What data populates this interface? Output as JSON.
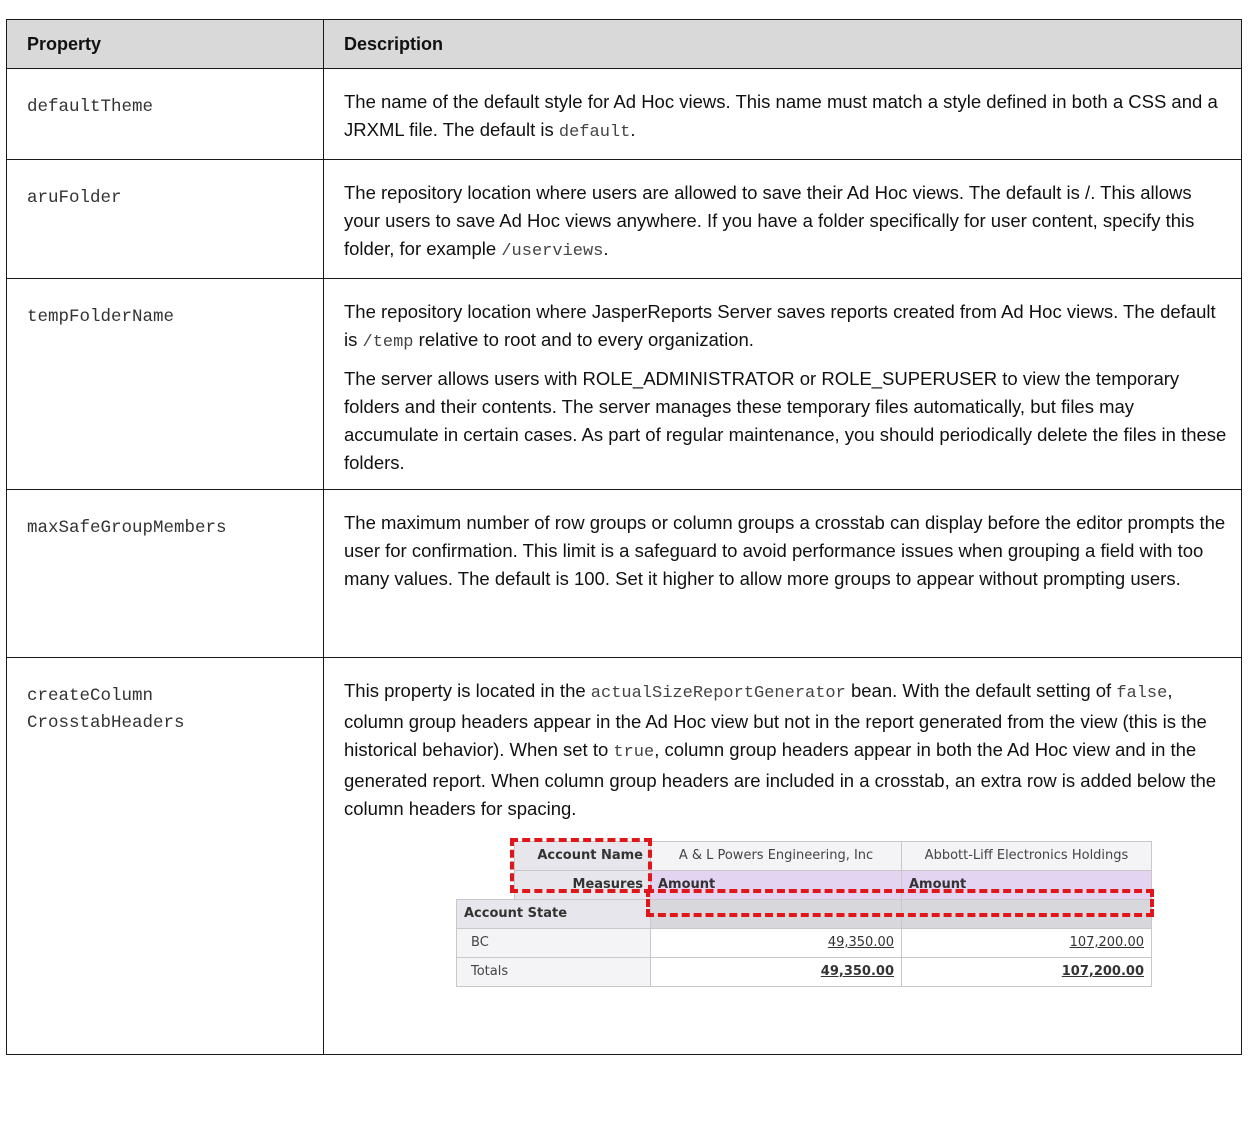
{
  "table": {
    "headers": [
      "Property",
      "Description"
    ],
    "rows": [
      {
        "name": "defaultTheme",
        "desc": [
          [
            "The name of the default style for Ad Hoc views. This name must match a style defined in both a CSS and a JRXML file. The default is ",
            "default",
            "."
          ]
        ]
      },
      {
        "name": "aruFolder",
        "desc": [
          [
            "The repository location where users are allowed to save their Ad Hoc views. The default is /. This allows your users to save Ad Hoc views anywhere. If you have a folder specifically for user content, specify this folder, for example ",
            "/userviews",
            "."
          ]
        ]
      },
      {
        "name": "tempFolderName",
        "desc": [
          [
            "The repository location where JasperReports Server saves reports created from Ad Hoc views. The default is ",
            "/temp",
            " relative to root and to every organization."
          ],
          [
            "The server allows users with ROLE_ADMINISTRATOR or ROLE_SUPERUSER to view the temporary folders and their contents. The server manages these temporary files automatically, but files may accumulate in certain cases. As part of regular maintenance, you should periodically delete the files in these folders."
          ]
        ]
      },
      {
        "name": "maxSafeGroupMembers",
        "desc": [
          [
            "The maximum number of row groups or column groups a crosstab can display before the editor prompts the user for confirmation. This limit is a safeguard to avoid performance issues when grouping a field with too many values. The default is 100. Set it higher to allow more groups to appear without prompting users."
          ]
        ]
      },
      {
        "name_line1": "createColumn",
        "name_line2": "CrosstabHeaders",
        "desc_parts": [
          "This property is located in the ",
          "actualSizeReportGenerator",
          " bean. With the default setting of ",
          "false",
          ", column group headers appear in the Ad Hoc view but not in the report generated from the view (this is the historical behavior). When set to ",
          "true",
          ", column group headers appear in both the Ad Hoc view and in the generated report. When column group headers are included in a crosstab, an extra row is added below the column headers for spacing."
        ]
      }
    ]
  },
  "crosstab": {
    "account_name_label": "Account Name",
    "measures_label": "Measures",
    "account_state_label": "Account State",
    "columns": [
      "A & L Powers Engineering, Inc",
      "Abbott-Liff Electronics Holdings"
    ],
    "measure": "Amount",
    "rows": [
      {
        "label": "BC",
        "values": [
          "49,350.00",
          "107,200.00"
        ]
      },
      {
        "label": "Totals",
        "values": [
          "49,350.00",
          "107,200.00"
        ]
      }
    ],
    "highlight_color": "#e0161b"
  }
}
